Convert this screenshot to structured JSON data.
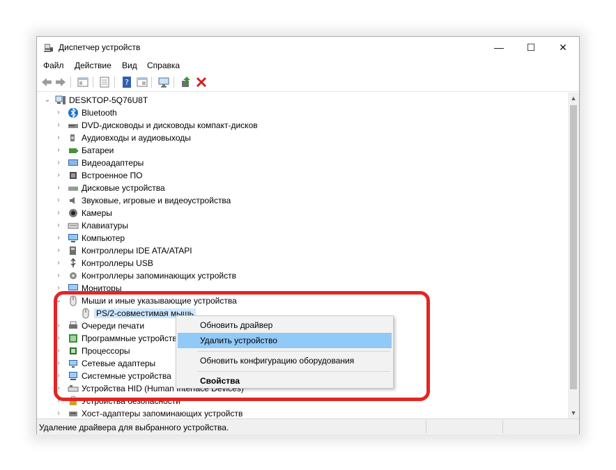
{
  "window": {
    "title": "Диспетчер устройств",
    "minimize": "—",
    "maximize": "☐",
    "close": "✕"
  },
  "menu": [
    "Файл",
    "Действие",
    "Вид",
    "Справка"
  ],
  "toolbar": [
    {
      "name": "back-icon"
    },
    {
      "name": "forward-icon"
    },
    {
      "name": "show-hide-tree-icon"
    },
    {
      "name": "properties-icon"
    },
    {
      "name": "help-icon"
    },
    {
      "name": "action-view-icon"
    },
    {
      "name": "monitor-scan-icon"
    },
    {
      "name": "update-driver-icon"
    },
    {
      "name": "uninstall-x-icon"
    }
  ],
  "tree": {
    "root": "DESKTOP-5Q76U8T",
    "items": [
      {
        "label": "Bluetooth",
        "icon": "bluetooth-icon"
      },
      {
        "label": "DVD-дисководы и дисководы компакт-дисков",
        "icon": "dvd-drive-icon"
      },
      {
        "label": "Аудиовходы и аудиовыходы",
        "icon": "audio-io-icon"
      },
      {
        "label": "Батареи",
        "icon": "battery-icon"
      },
      {
        "label": "Видеоадаптеры",
        "icon": "display-adapter-icon"
      },
      {
        "label": "Встроенное ПО",
        "icon": "firmware-icon"
      },
      {
        "label": "Дисковые устройства",
        "icon": "disk-drive-icon"
      },
      {
        "label": "Звуковые, игровые и видеоустройства",
        "icon": "sound-video-icon"
      },
      {
        "label": "Камеры",
        "icon": "camera-icon"
      },
      {
        "label": "Клавиатуры",
        "icon": "keyboard-icon"
      },
      {
        "label": "Компьютер",
        "icon": "computer-icon"
      },
      {
        "label": "Контроллеры IDE ATA/ATAPI",
        "icon": "ide-controller-icon"
      },
      {
        "label": "Контроллеры USB",
        "icon": "usb-controller-icon"
      },
      {
        "label": "Контроллеры запоминающих устройств",
        "icon": "storage-controller-icon"
      },
      {
        "label": "Мониторы",
        "icon": "monitor-icon"
      },
      {
        "label": "Мыши и иные указывающие устройства",
        "icon": "mouse-icon",
        "expanded": true
      },
      {
        "label": "PS/2-совместимая мышь",
        "icon": "mouse-icon",
        "child": true,
        "selected": true
      },
      {
        "label": "Очереди печати",
        "icon": "print-queue-icon"
      },
      {
        "label": "Программные устройства",
        "icon": "software-device-icon"
      },
      {
        "label": "Процессоры",
        "icon": "processor-icon"
      },
      {
        "label": "Сетевые адаптеры",
        "icon": "network-adapter-icon"
      },
      {
        "label": "Системные устройства",
        "icon": "system-device-icon"
      },
      {
        "label": "Устройства HID (Human Interface Devices)",
        "icon": "hid-icon"
      },
      {
        "label": "Устройства безопасности",
        "icon": "security-device-icon"
      },
      {
        "label": "Хост-адаптеры запоминающих устройств",
        "icon": "storage-host-icon"
      }
    ]
  },
  "context_menu": {
    "update_driver": "Обновить драйвер",
    "uninstall_device": "Удалить устройство",
    "scan_hardware": "Обновить конфигурацию оборудования",
    "properties": "Свойства"
  },
  "status": {
    "text": "Удаление драйвера для выбранного устройства."
  },
  "colors": {
    "highlight_box": "#e52424",
    "menu_highlight": "#91c9f7",
    "selection": "#cde8ff"
  }
}
